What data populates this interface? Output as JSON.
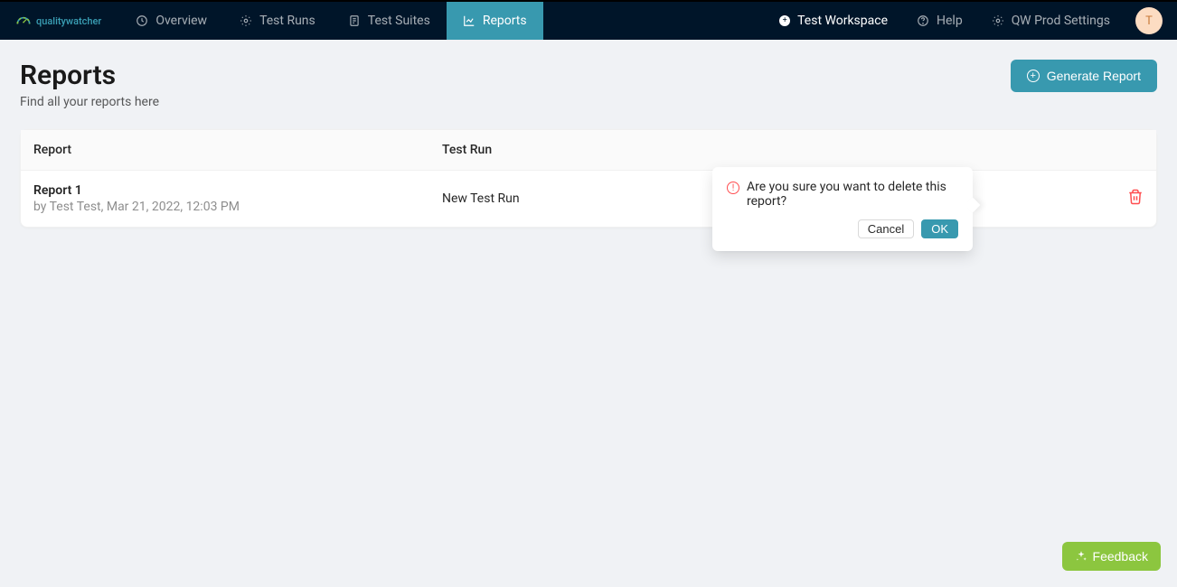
{
  "brand": {
    "name": "qualitywatcher"
  },
  "nav": {
    "items": [
      {
        "label": "Overview"
      },
      {
        "label": "Test Runs"
      },
      {
        "label": "Test Suites"
      },
      {
        "label": "Reports"
      }
    ]
  },
  "headerRight": {
    "workspace": "Test Workspace",
    "help": "Help",
    "settings": "QW Prod Settings",
    "avatarInitial": "T"
  },
  "page": {
    "title": "Reports",
    "subtitle": "Find all your reports here",
    "generateBtn": "Generate Report"
  },
  "table": {
    "headers": {
      "report": "Report",
      "run": "Test Run"
    },
    "rows": [
      {
        "name": "Report 1",
        "meta": "by Test Test, Mar 21, 2022, 12:03 PM",
        "run": "New Test Run"
      }
    ]
  },
  "popover": {
    "text": "Are you sure you want to delete this report?",
    "cancel": "Cancel",
    "ok": "OK"
  },
  "feedback": {
    "label": "Feedback"
  }
}
